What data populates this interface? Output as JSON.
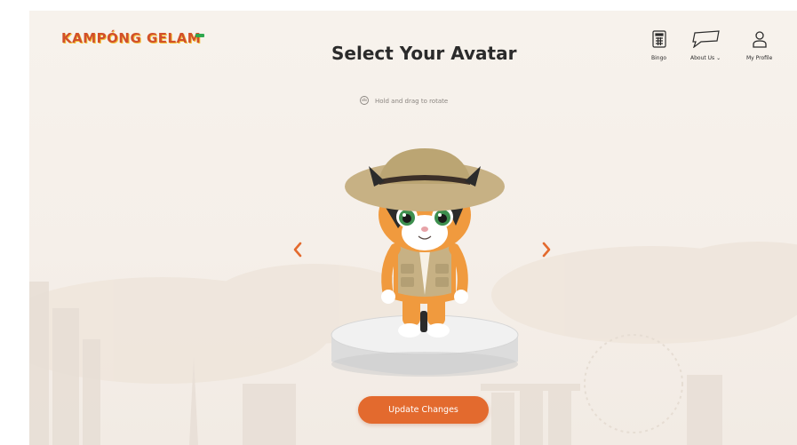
{
  "header": {
    "logo_text": "KAMPÓNG GELAM",
    "title": "Select Your Avatar",
    "hint": "Hold and drag to rotate"
  },
  "nav": {
    "bingo_label": "Bingo",
    "about_label": "About Us ⌄",
    "profile_label": "My Profile"
  },
  "actions": {
    "update_label": "Update Changes"
  },
  "colors": {
    "accent": "#e36a2e",
    "logo": "#d2502a",
    "background": "#f5efe9"
  },
  "icons": {
    "bingo": "bingo-card-icon",
    "about": "speech-bubble-icon",
    "profile": "user-icon",
    "rotate": "rotate-hand-icon",
    "prev": "chevron-left-icon",
    "next": "chevron-right-icon"
  }
}
